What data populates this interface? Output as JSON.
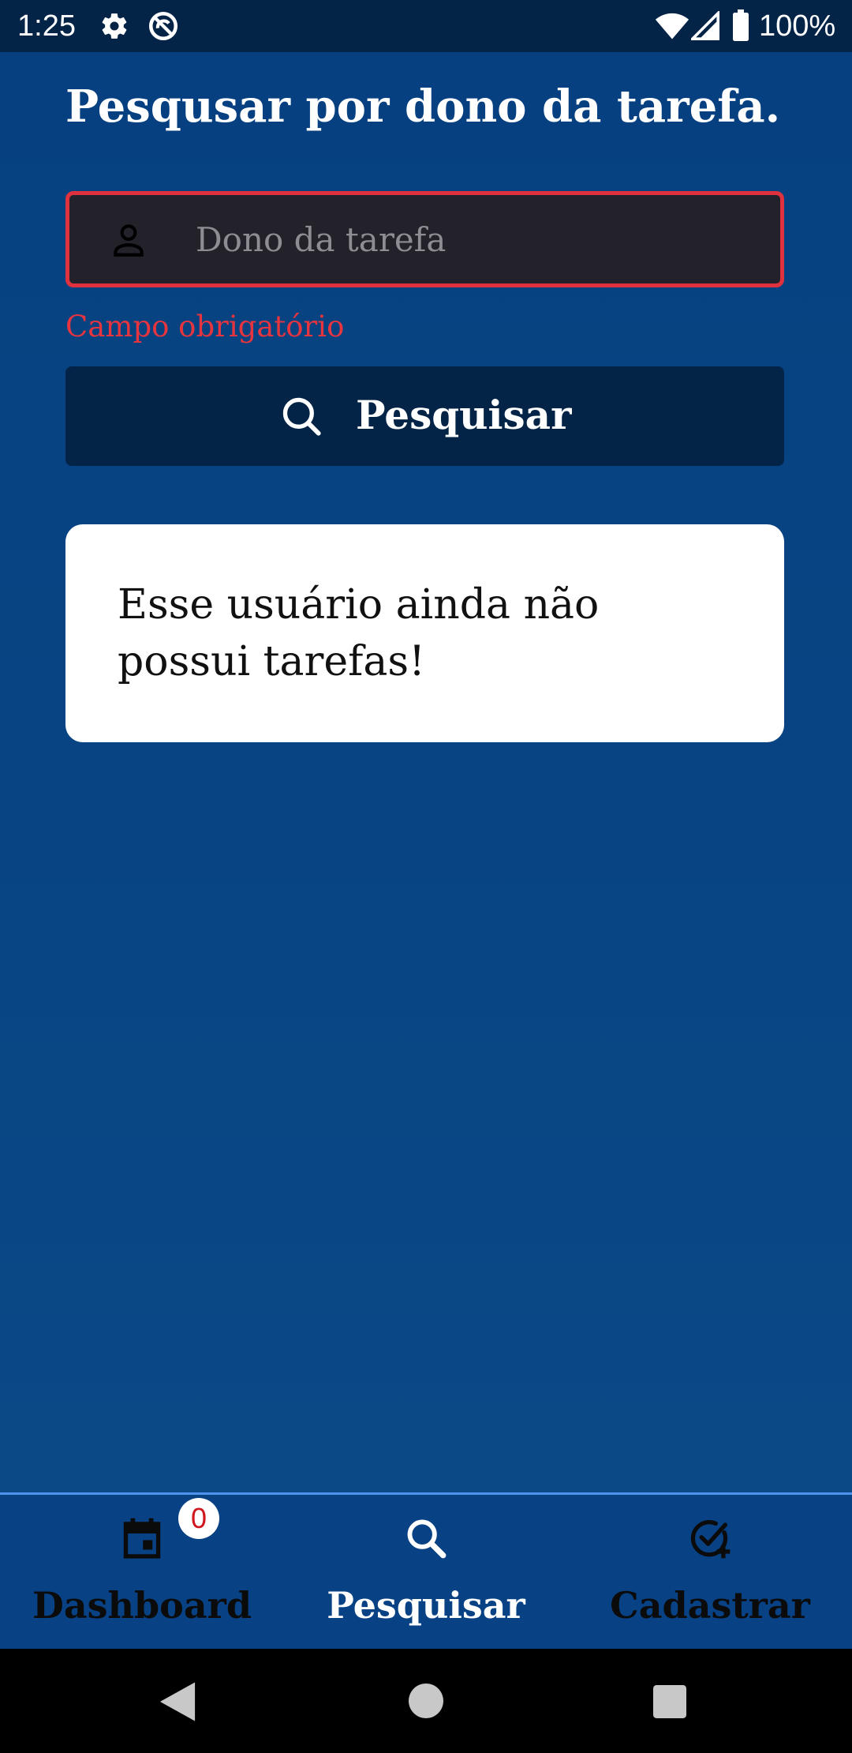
{
  "status_bar": {
    "time": "1:25",
    "battery_text": "100%",
    "icons": [
      "gear-icon",
      "do-not-disturb-icon",
      "wifi-icon",
      "signal-icon",
      "battery-icon"
    ]
  },
  "page": {
    "title": "Pesqusar por dono da tarefa."
  },
  "search": {
    "placeholder": "Dono da tarefa",
    "value": "",
    "icon": "person-icon",
    "error": "Campo obrigatório",
    "button_label": "Pesquisar",
    "button_icon": "search-icon"
  },
  "result": {
    "message": "Esse usuário ainda não possui tarefas!"
  },
  "bottom_nav": {
    "items": [
      {
        "label": "Dashboard",
        "icon": "calendar-icon",
        "badge": "0",
        "active": false
      },
      {
        "label": "Pesquisar",
        "icon": "search-icon",
        "active": true
      },
      {
        "label": "Cadastrar",
        "icon": "check-plus-icon",
        "active": false
      }
    ]
  },
  "colors": {
    "background": "#0a4483",
    "status_bar": "#032347",
    "button": "#032347",
    "error": "#e0323e",
    "field_background": "#23222b",
    "nav_border": "#4e93ec",
    "badge_text": "#d0161f"
  }
}
